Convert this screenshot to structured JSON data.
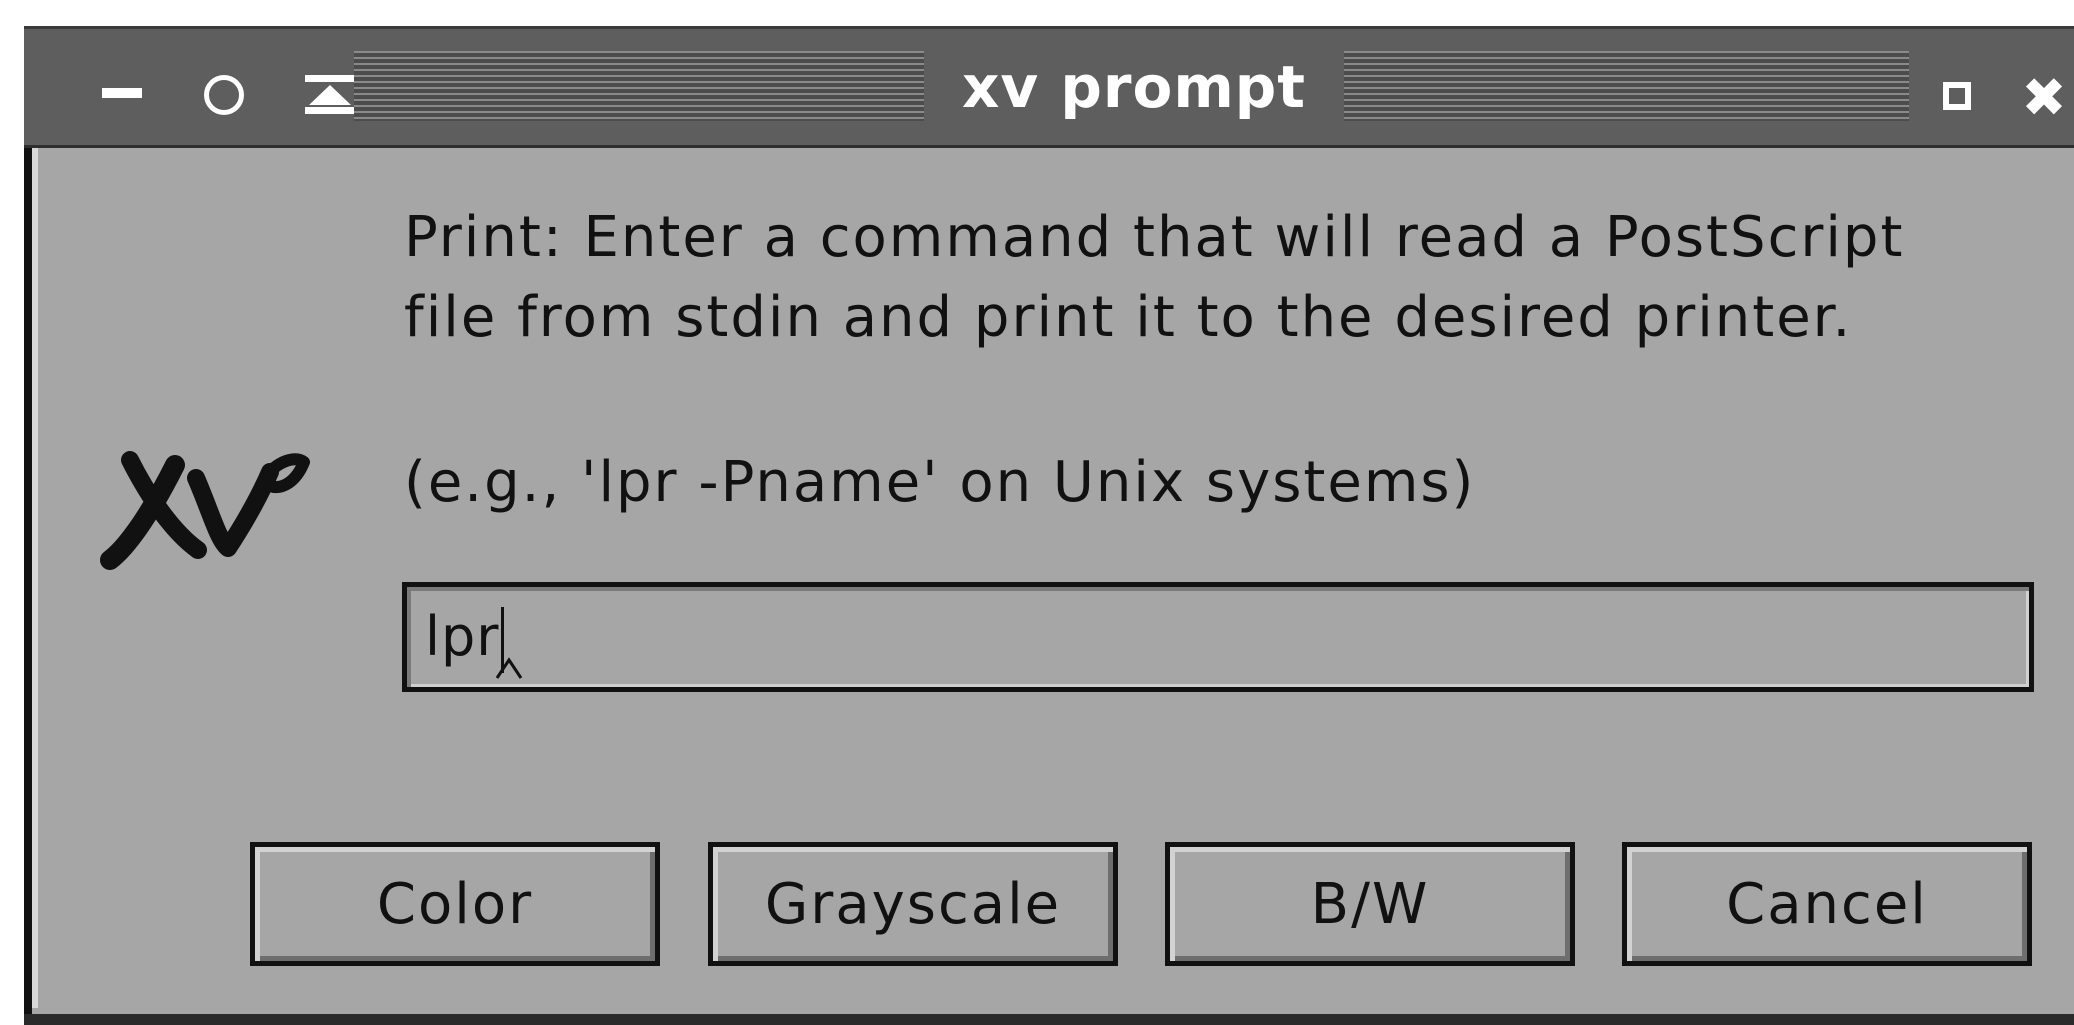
{
  "window": {
    "title": "xv prompt"
  },
  "titlebar": {
    "close_glyph": "✖",
    "icons": [
      "minimize-icon",
      "restore-icon",
      "shade-icon",
      "maximize-icon",
      "close-icon"
    ]
  },
  "prompt": {
    "line1": "Print:  Enter a command that will read a PostScript",
    "line2": "file from stdin and print it to the desired printer.",
    "example": "(e.g., 'lpr -Pname' on Unix systems)",
    "logo_text": "xv"
  },
  "input": {
    "value": "lpr"
  },
  "buttons": {
    "color": "Color",
    "grayscale": "Grayscale",
    "bw": "B/W",
    "cancel": "Cancel"
  },
  "colors": {
    "titlebar": "#5e5e5e",
    "body": "#a6a6a6",
    "text": "#111111"
  }
}
